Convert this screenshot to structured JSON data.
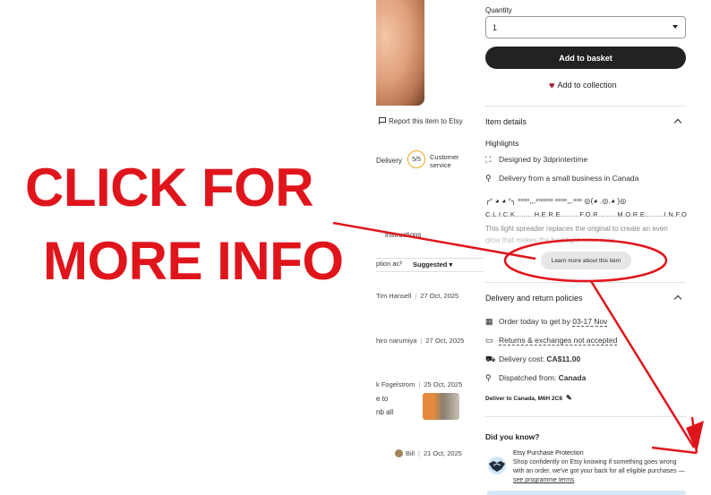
{
  "overlay": {
    "line1": "CLICK FOR",
    "line2": "MORE INFO"
  },
  "left": {
    "report_link": "Report this item to Etsy",
    "delivery_fragment": "Delivery",
    "score": "5/5",
    "customer_service": "Customer service",
    "instructions_fragment": "instructions",
    "option_fragment": "ption ac",
    "sort_label": "Suggested",
    "reviews": [
      {
        "name": "Tim Hansell",
        "date": "27 Oct, 2025"
      },
      {
        "name": "hiro narumiya",
        "date": "27 Oct, 2025"
      },
      {
        "name": "k Fogelstrom",
        "date": "25 Oct, 2025",
        "lines": [
          "e to",
          "nb all"
        ]
      },
      {
        "name": "Bill",
        "date": "21 Oct, 2025"
      }
    ]
  },
  "product": {
    "quantity_label": "Quantity",
    "quantity_value": "1",
    "add_to_basket": "Add to basket",
    "add_to_collection": "Add to collection"
  },
  "item_details": {
    "title": "Item details",
    "highlights_label": "Highlights",
    "designed_prefix": "Designed by ",
    "designer": "3dprintertime",
    "delivery_small_business": "Delivery from a small business in Canada",
    "description_line1": "╭ᐡ ◕ ◕ ᐡ╮ ᵒᵒᵒᵒ,,.ᵉᵒᵒᵒᵒᵒ ᵒᵒᵒᵒ,,.ᵉᵒᵒ ◎(◕ .◎.◕ )◎",
    "description_line2": "C.L.I.C.K.........H.E.R.E.........F.O.R.........M.O.R.E.........I.N.F.O",
    "description_line3": "This light spreader replaces the original to create an even glow that makes the backlight more even",
    "learn_more": "Learn more about this item"
  },
  "delivery": {
    "title": "Delivery and return policies",
    "order_prefix": "Order today to get by ",
    "order_date": "03-17 Nov",
    "returns": "Returns & exchanges not accepted",
    "cost_label": "Delivery cost: ",
    "cost_value": "CA$11.00",
    "dispatched_label": "Dispatched from: ",
    "dispatched_value": "Canada",
    "deliver_to": "Deliver to Canada, M6H 2C8"
  },
  "did_you_know": {
    "title": "Did you know?",
    "protection_title": "Etsy Purchase Protection",
    "protection_text": "Shop confidently on Etsy knowing if something goes wrong with an order, we've got your back for all eligible purchases — ",
    "protection_link": "see programme terms"
  },
  "colors": {
    "overlay_red": "#e0151c",
    "button_dark": "#222222",
    "heart": "#a61a2e",
    "score_ring": "#f1a41d"
  }
}
